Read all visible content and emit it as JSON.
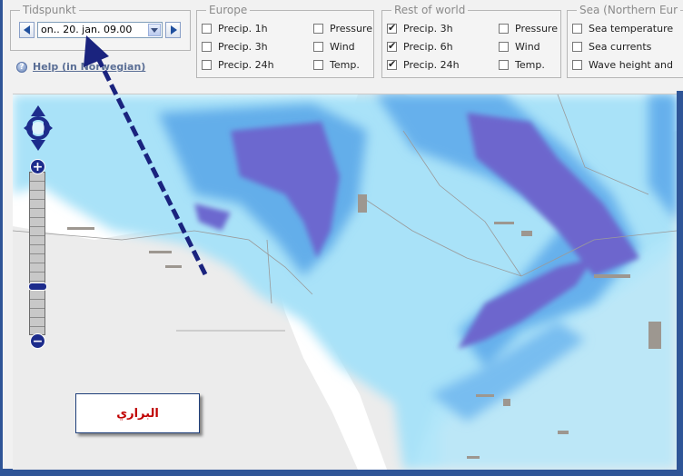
{
  "tidspunkt": {
    "legend": "Tidspunkt",
    "selected_time": "on.. 20. jan. 09.00",
    "prev_icon": "arrow-left-icon",
    "next_icon": "arrow-right-icon"
  },
  "help": {
    "label": "Help (in Norwegian)",
    "icon": "help-icon"
  },
  "europe": {
    "legend": "Europe",
    "options": [
      {
        "label": "Precip. 1h",
        "checked": false
      },
      {
        "label": "Precip. 3h",
        "checked": false
      },
      {
        "label": "Precip. 24h",
        "checked": false
      },
      {
        "label": "Pressure",
        "checked": false
      },
      {
        "label": "Wind",
        "checked": false
      },
      {
        "label": "Temp.",
        "checked": false
      }
    ]
  },
  "rest_of_world": {
    "legend": "Rest of world",
    "options": [
      {
        "label": "Precip. 3h",
        "checked": true
      },
      {
        "label": "Precip. 6h",
        "checked": true
      },
      {
        "label": "Precip. 24h",
        "checked": true
      },
      {
        "label": "Pressure",
        "checked": false
      },
      {
        "label": "Wind",
        "checked": false
      },
      {
        "label": "Temp.",
        "checked": false
      }
    ]
  },
  "sea": {
    "legend": "Sea (Northern Eur",
    "options": [
      {
        "label": "Sea temperature",
        "checked": false
      },
      {
        "label": "Sea currents",
        "checked": false
      },
      {
        "label": "Wave height and dir",
        "checked": false
      }
    ]
  },
  "map": {
    "zoom_in": "+",
    "zoom_out": "−",
    "pan_icon": "pan-compass-icon",
    "caption": "البراري"
  },
  "colors": {
    "frame": "#2f5597",
    "precip_light": "#9fdcf6",
    "precip_mid": "#5fa8ea",
    "precip_heavy": "#6a64c9",
    "annotation_arrow": "#1a237e"
  }
}
